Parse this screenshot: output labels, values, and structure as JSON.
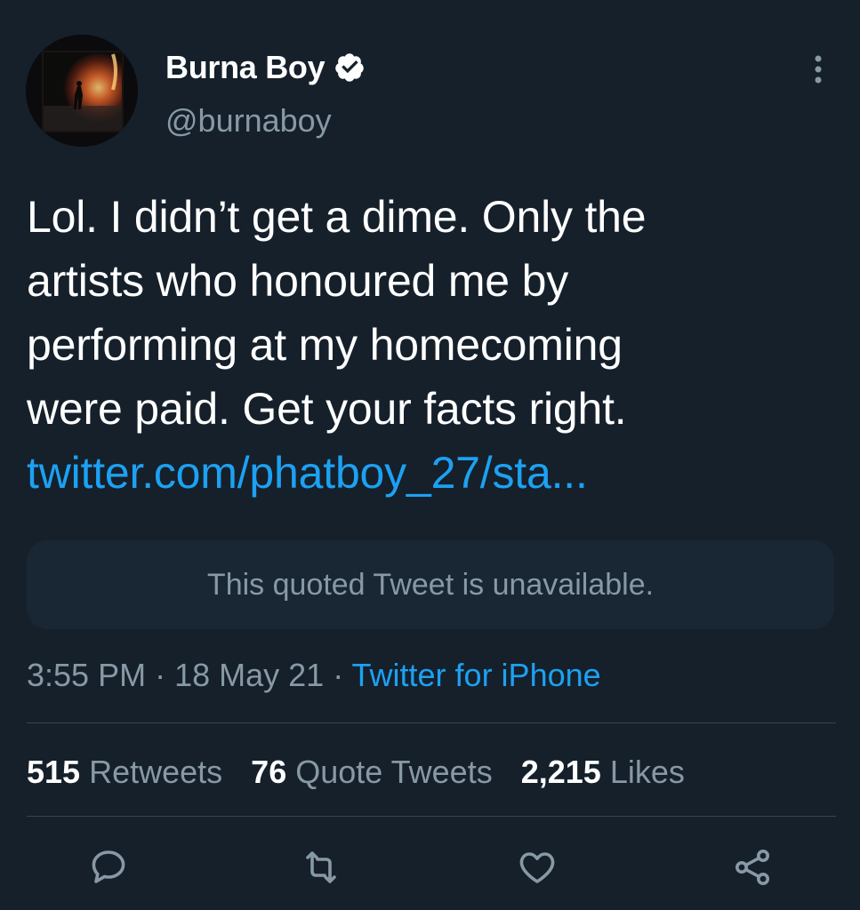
{
  "author": {
    "name": "Burna Boy",
    "handle": "@burnaboy",
    "verified": true
  },
  "tweet": {
    "text_lines": [
      "Lol. I didn’t get a dime. Only the",
      "artists who honoured me by",
      "performing at my homecoming",
      "were paid. Get your facts right."
    ],
    "link": "twitter.com/phatboy_27/sta..."
  },
  "quoted": {
    "text": "This quoted Tweet is unavailable."
  },
  "meta": {
    "time": "3:55 PM",
    "separator1": " · ",
    "date": "18 May 21",
    "separator2": " · ",
    "source": "Twitter for iPhone"
  },
  "stats": [
    {
      "value": "515",
      "label": "Retweets"
    },
    {
      "value": "76",
      "label": "Quote Tweets"
    },
    {
      "value": "2,215",
      "label": "Likes"
    }
  ],
  "icons": {
    "verified": "verified-badge-icon",
    "more": "more-vertical-icon",
    "reply": "reply-icon",
    "retweet": "retweet-icon",
    "like": "heart-icon",
    "share": "share-icon"
  },
  "colors": {
    "background": "#15202b",
    "accent": "#1da1f2",
    "secondary_text": "#8899a6",
    "divider": "#38444d"
  }
}
